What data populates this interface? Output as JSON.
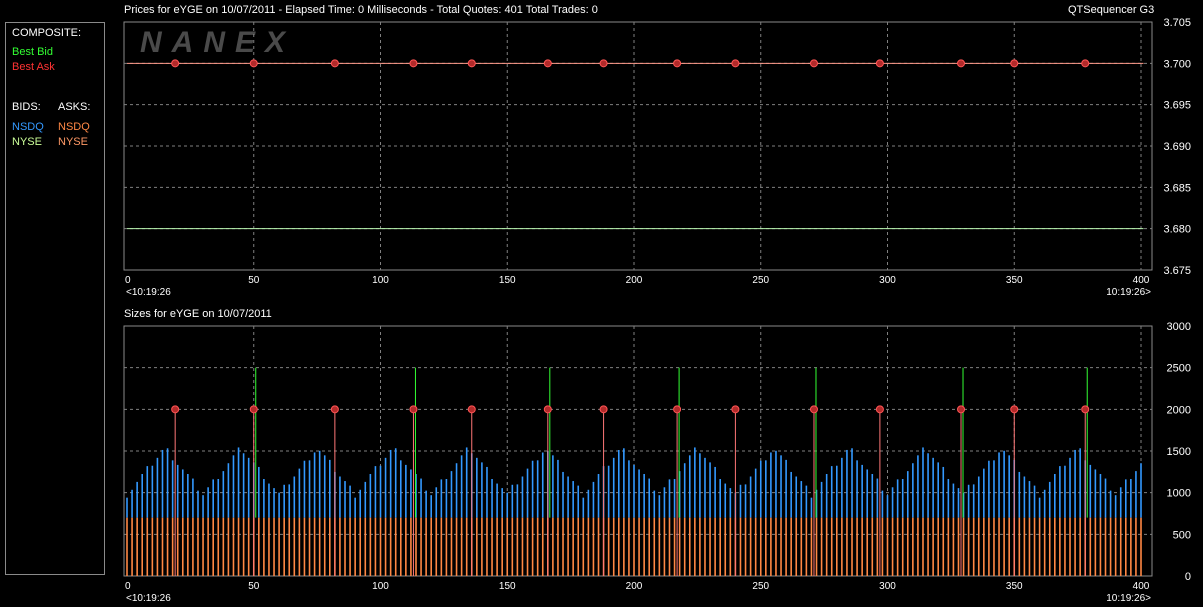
{
  "header": {
    "prices_title": "Prices for  eYGE  on  10/07/2011  -  Elapsed Time: 0 Milliseconds  -  Total Quotes: 401  Total Trades: 0",
    "app_name": "QTSequencer G3",
    "sizes_title": "Sizes for  eYGE  on  10/07/2011",
    "watermark": "NANEX"
  },
  "legend": {
    "composite_label": "COMPOSITE:",
    "best_bid": "Best Bid",
    "best_ask": "Best Ask",
    "bids_label": "BIDS:",
    "asks_label": "ASKS:",
    "bid_nsdq": "NSDQ",
    "bid_nyse": "NYSE",
    "ask_nsdq": "NSDQ",
    "ask_nyse": "NYSE"
  },
  "colors": {
    "best_bid": "#33ff33",
    "best_ask": "#ff3333",
    "bid_nsdq": "#3399ff",
    "bid_nyse": "#ccff99",
    "ask_nsdq": "#ff8844",
    "ask_nyse": "#ff9966",
    "trade_marker": "#ff3333",
    "grid": "#808080"
  },
  "chart_data": [
    {
      "type": "line",
      "title": "Prices for  eYGE  on  10/07/2011",
      "x_ticks": [
        0,
        50,
        100,
        150,
        200,
        250,
        300,
        350,
        400
      ],
      "xlim": [
        0,
        401
      ],
      "ylim": [
        3.675,
        3.705
      ],
      "y_ticks": [
        "3.705",
        "3.700",
        "3.695",
        "3.690",
        "3.685",
        "3.680",
        "3.675"
      ],
      "time_start": "<10:19:26",
      "time_end": "10:19:26>",
      "grid": true,
      "series": [
        {
          "name": "Best Ask",
          "x": [
            0,
            401
          ],
          "y": [
            3.7,
            3.7
          ]
        },
        {
          "name": "Best Bid",
          "x": [
            0,
            401
          ],
          "y": [
            3.68,
            3.68
          ]
        }
      ],
      "markers": {
        "x": [
          19,
          50,
          82,
          113,
          136,
          166,
          188,
          217,
          240,
          271,
          297,
          329,
          350,
          378
        ],
        "y": 3.7
      }
    },
    {
      "type": "bar",
      "title": "Sizes for  eYGE  on  10/07/2011",
      "x_ticks": [
        0,
        50,
        100,
        150,
        200,
        250,
        300,
        350,
        400
      ],
      "xlim": [
        0,
        401
      ],
      "ylim": [
        0,
        3000
      ],
      "y_ticks": [
        "3000",
        "2500",
        "2000",
        "1500",
        "1000",
        "500",
        "0"
      ],
      "time_start": "<10:19:26",
      "time_end": "10:19:26>",
      "grid": true,
      "ask_size": 700,
      "bid_size_range": [
        700,
        1500
      ],
      "marker_size": 2000,
      "spike_size": 2500,
      "markers_x": [
        19,
        50,
        82,
        113,
        136,
        166,
        188,
        217,
        240,
        271,
        297,
        329,
        350,
        378
      ],
      "spikes_x": [
        50,
        113,
        166,
        217,
        271,
        329,
        378
      ]
    }
  ]
}
